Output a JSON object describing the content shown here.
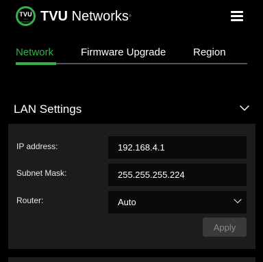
{
  "brand": {
    "badge": "TVU",
    "badge_sub": "TVU NETWORKS",
    "name_bold": "TVU",
    "name_regular": "Networks",
    "trademark": "®",
    "accent_color": "#33b24a",
    "menu_icon": "hamburger-menu-icon"
  },
  "tabs": [
    {
      "label": "Network",
      "active": true
    },
    {
      "label": "Firmware Upgrade",
      "active": false
    },
    {
      "label": "Region",
      "active": false
    }
  ],
  "lan_settings": {
    "title": "LAN Settings",
    "collapse_icon": "chevron-down-icon",
    "fields": {
      "ip_address": {
        "label": "IP address:",
        "value": "192.168.4.1"
      },
      "subnet_mask": {
        "label": "Subnet Mask:",
        "value": "255.255.255.224"
      },
      "router": {
        "label": "Router:",
        "value": "Auto"
      }
    },
    "apply_label": "Apply"
  }
}
